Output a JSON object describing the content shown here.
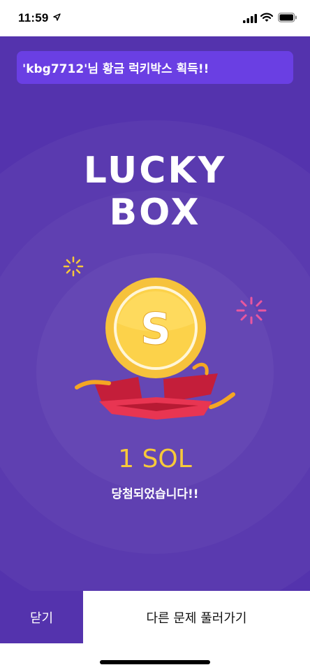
{
  "status_bar": {
    "time": "11:59",
    "icons": [
      "location-arrow-icon",
      "cellular-signal-icon",
      "wifi-icon",
      "battery-icon"
    ]
  },
  "notice": {
    "text": "'kbg7712'님 황금 럭키박스 획득!!"
  },
  "title": {
    "line1": "LUCKY",
    "line2": "BOX"
  },
  "coin": {
    "symbol": "S",
    "icon": "coin-icon"
  },
  "prize": {
    "amount": "1 SOL",
    "message": "당첨되었습니다!!"
  },
  "buttons": {
    "close_label": "닫기",
    "next_label": "다른 문제 풀러가기"
  },
  "colors": {
    "panel": "#5433ad",
    "notice_bg": "#6a3fe3",
    "coin_gold": "#f7c93a",
    "box_red": "#d8263f",
    "ribbon": "#f5a623",
    "spark_pink": "#e9579f"
  }
}
